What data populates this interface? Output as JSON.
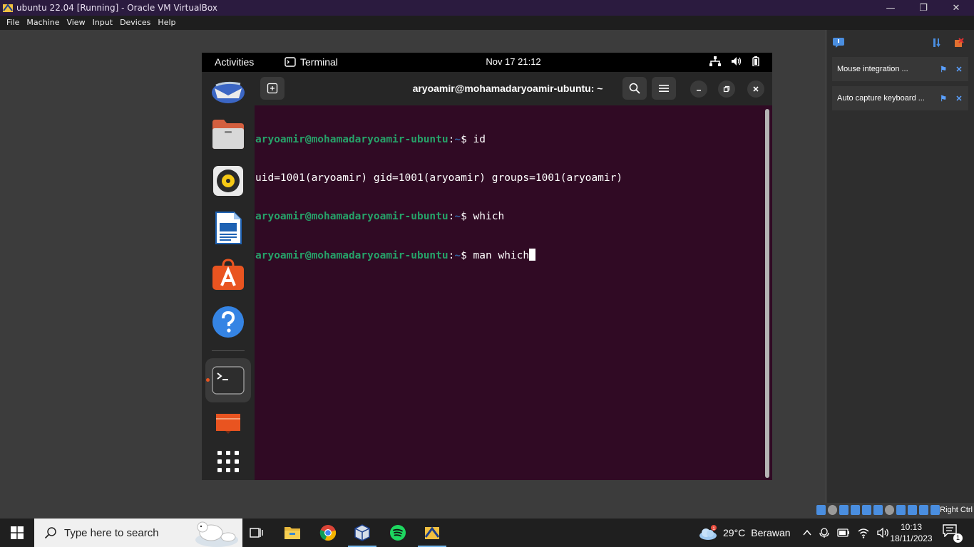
{
  "vbox": {
    "title": "ubuntu 22.04 [Running] - Oracle VM VirtualBox",
    "menu": [
      "File",
      "Machine",
      "View",
      "Input",
      "Devices",
      "Help"
    ],
    "window_controls": [
      "—",
      "❐",
      "✕"
    ],
    "notifications": [
      {
        "text": "Mouse integration ...",
        "pin": "⚑",
        "close": "✕"
      },
      {
        "text": "Auto capture keyboard ...",
        "pin": "⚑",
        "close": "✕"
      }
    ],
    "host_key": "Right Ctrl"
  },
  "ubuntu": {
    "topbar": {
      "activities": "Activities",
      "app_name": "Terminal",
      "clock": "Nov 17  21:12"
    },
    "dock": [
      {
        "name": "thunderbird-icon"
      },
      {
        "name": "files-icon"
      },
      {
        "name": "rhythmbox-icon"
      },
      {
        "name": "libreoffice-writer-icon"
      },
      {
        "name": "app-center-icon"
      },
      {
        "name": "help-icon"
      },
      {
        "name": "terminal-icon"
      },
      {
        "name": "show-desktop-icon"
      },
      {
        "name": "show-apps-icon"
      }
    ],
    "terminal": {
      "title": "aryoamir@mohamadaryoamir-ubuntu: ~",
      "lines": [
        {
          "prompt": "aryoamir@mohamadaryoamir-ubuntu",
          "path": "~",
          "cmd": "$ id"
        },
        {
          "output": "uid=1001(aryoamir) gid=1001(aryoamir) groups=1001(aryoamir)"
        },
        {
          "prompt": "aryoamir@mohamadaryoamir-ubuntu",
          "path": "~",
          "cmd": "$ which"
        },
        {
          "prompt": "aryoamir@mohamadaryoamir-ubuntu",
          "path": "~",
          "cmd": "$ man which"
        }
      ]
    }
  },
  "windows": {
    "search_placeholder": "Type here to search",
    "weather_temp": "29°C",
    "weather_desc": "Berawan",
    "time": "10:13",
    "date": "18/11/2023",
    "notification_count": "1"
  },
  "colors": {
    "terminal_bg": "#300a24",
    "prompt_green": "#26a269",
    "path_blue": "#3465a4",
    "ubuntu_orange": "#e95420"
  }
}
